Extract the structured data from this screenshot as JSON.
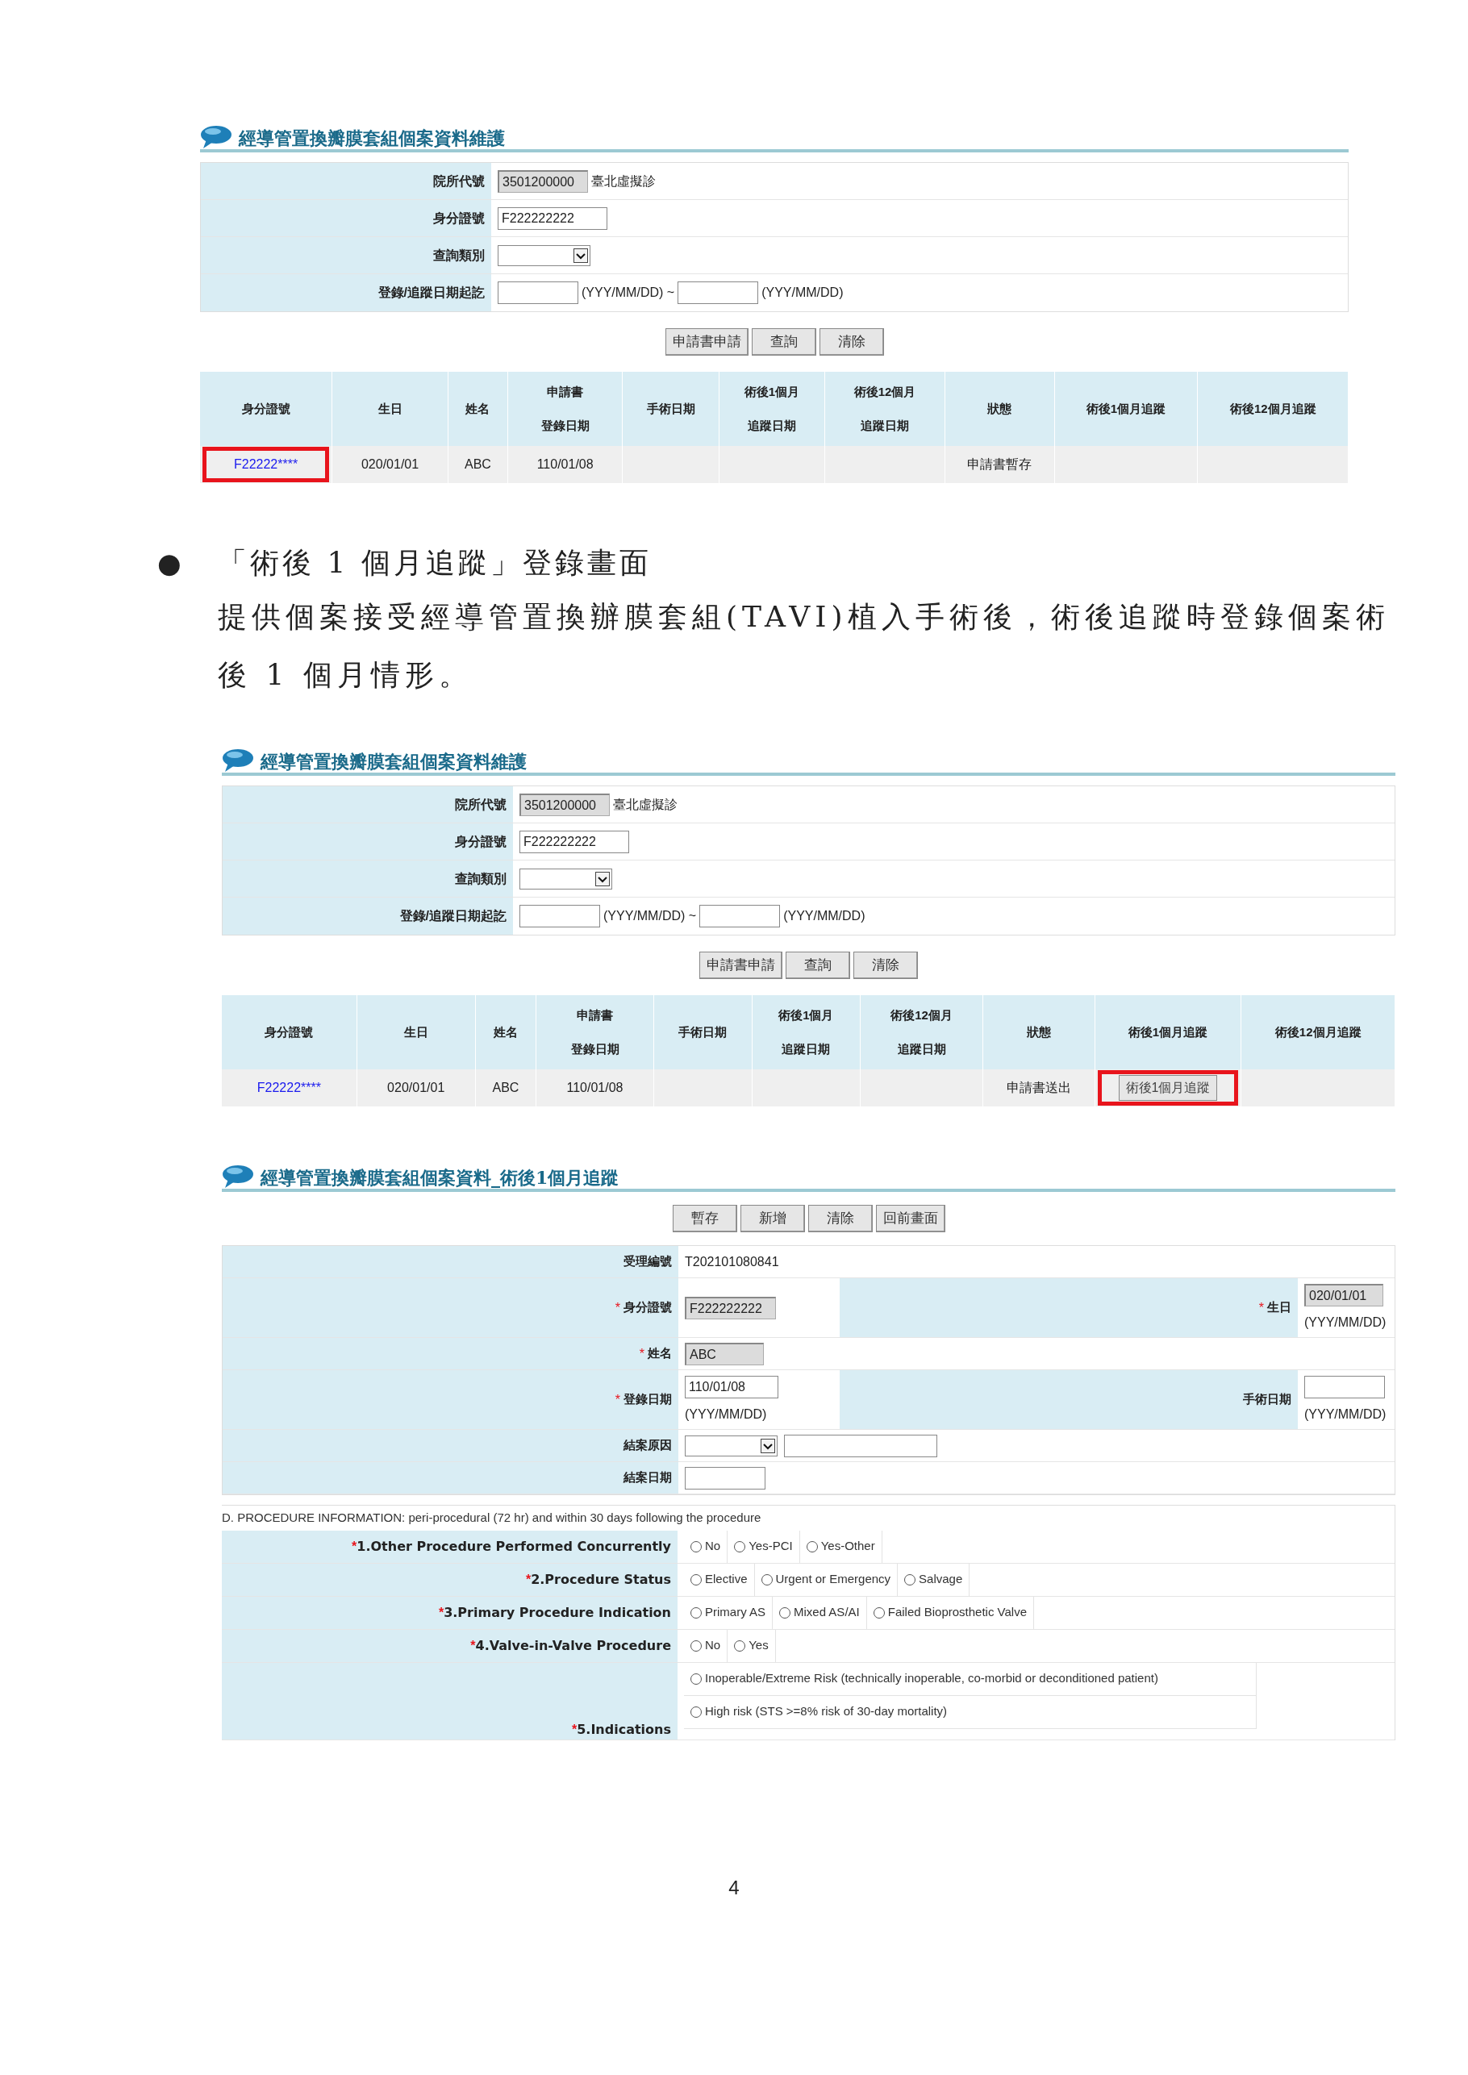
{
  "query_screens": [
    {
      "title": "經導管置換瓣膜套組個案資料維護",
      "fields": [
        {
          "label": "院所代號",
          "parts": [
            {
              "kind": "readonly",
              "value": "3501200000"
            },
            {
              "kind": "text",
              "text": "臺北虛擬診"
            }
          ]
        },
        {
          "label": "身分證號",
          "parts": [
            {
              "kind": "input",
              "value": "F222222222"
            }
          ]
        },
        {
          "label": "查詢類別",
          "parts": [
            {
              "kind": "select"
            }
          ]
        },
        {
          "label": "登錄/追蹤日期起訖",
          "parts": [
            {
              "kind": "input"
            },
            {
              "kind": "text",
              "text": "(YYY/MM/DD) ~"
            },
            {
              "kind": "input"
            },
            {
              "kind": "text",
              "text": "(YYY/MM/DD)"
            }
          ]
        }
      ],
      "buttons": [
        "申請書申請",
        "查詢",
        "清除"
      ],
      "columns": [
        {
          "lines": [
            "身分證號"
          ]
        },
        {
          "lines": [
            "生日"
          ]
        },
        {
          "lines": [
            "姓名"
          ]
        },
        {
          "lines": [
            "申請書",
            "登錄日期"
          ]
        },
        {
          "lines": [
            "手術日期"
          ]
        },
        {
          "lines": [
            "術後1個月",
            "追蹤日期"
          ]
        },
        {
          "lines": [
            "術後12個月",
            "追蹤日期"
          ]
        },
        {
          "lines": [
            "狀態"
          ]
        },
        {
          "lines": [
            "術後1個月追蹤"
          ]
        },
        {
          "lines": [
            "術後12個月追蹤"
          ]
        }
      ],
      "rows": [
        {
          "cells": [
            {
              "kind": "link",
              "text": "F22222****",
              "highlighted": true
            },
            {
              "kind": "text",
              "text": "020/01/01",
              "highlighted": false
            },
            {
              "kind": "text",
              "text": "ABC",
              "highlighted": false
            },
            {
              "kind": "text",
              "text": "110/01/08",
              "highlighted": false
            },
            {
              "kind": "empty",
              "highlighted": false
            },
            {
              "kind": "empty",
              "highlighted": false
            },
            {
              "kind": "empty",
              "highlighted": false
            },
            {
              "kind": "text",
              "text": "申請書暫存",
              "highlighted": false
            },
            {
              "kind": "empty",
              "highlighted": false
            },
            {
              "kind": "empty",
              "highlighted": false
            }
          ]
        }
      ]
    },
    {
      "title": "經導管置換瓣膜套組個案資料維護",
      "fields": [
        {
          "label": "院所代號",
          "parts": [
            {
              "kind": "readonly",
              "value": "3501200000"
            },
            {
              "kind": "text",
              "text": "臺北虛擬診"
            }
          ]
        },
        {
          "label": "身分證號",
          "parts": [
            {
              "kind": "input",
              "value": "F222222222"
            }
          ]
        },
        {
          "label": "查詢類別",
          "parts": [
            {
              "kind": "select"
            }
          ]
        },
        {
          "label": "登錄/追蹤日期起訖",
          "parts": [
            {
              "kind": "input"
            },
            {
              "kind": "text",
              "text": "(YYY/MM/DD) ~"
            },
            {
              "kind": "input"
            },
            {
              "kind": "text",
              "text": "(YYY/MM/DD)"
            }
          ]
        }
      ],
      "buttons": [
        "申請書申請",
        "查詢",
        "清除"
      ],
      "columns": [
        {
          "lines": [
            "身分證號"
          ]
        },
        {
          "lines": [
            "生日"
          ]
        },
        {
          "lines": [
            "姓名"
          ]
        },
        {
          "lines": [
            "申請書",
            "登錄日期"
          ]
        },
        {
          "lines": [
            "手術日期"
          ]
        },
        {
          "lines": [
            "術後1個月",
            "追蹤日期"
          ]
        },
        {
          "lines": [
            "術後12個月",
            "追蹤日期"
          ]
        },
        {
          "lines": [
            "狀態"
          ]
        },
        {
          "lines": [
            "術後1個月追蹤"
          ]
        },
        {
          "lines": [
            "術後12個月追蹤"
          ]
        }
      ],
      "rows": [
        {
          "cells": [
            {
              "kind": "link",
              "text": "F22222****",
              "highlighted": false
            },
            {
              "kind": "text",
              "text": "020/01/01",
              "highlighted": false
            },
            {
              "kind": "text",
              "text": "ABC",
              "highlighted": false
            },
            {
              "kind": "text",
              "text": "110/01/08",
              "highlighted": false
            },
            {
              "kind": "empty",
              "highlighted": false
            },
            {
              "kind": "empty",
              "highlighted": false
            },
            {
              "kind": "empty",
              "highlighted": false
            },
            {
              "kind": "text",
              "text": "申請書送出",
              "highlighted": false
            },
            {
              "kind": "button",
              "text": "術後1個月追蹤",
              "highlighted": true
            },
            {
              "kind": "empty",
              "highlighted": false
            }
          ]
        }
      ]
    }
  ],
  "section": {
    "bullet": "●",
    "heading": "「術後 1 個月追蹤」登錄畫面",
    "paragraph": "提供個案接受經導管置換辦膜套組(TAVI)植入手術後，術後追蹤時登錄個案術後 1 個月情形。"
  },
  "followup_form": {
    "title": "經導管置換瓣膜套組個案資料_術後1個月追蹤",
    "buttons": [
      "暫存",
      "新增",
      "清除",
      "回前畫面"
    ],
    "rows": [
      {
        "label": "受理編號",
        "parts": [
          {
            "kind": "text",
            "text": "T202101080841"
          }
        ]
      },
      {
        "mark": "*",
        "label": "身分證號",
        "parts": [
          {
            "kind": "readonly",
            "value": "F222222222"
          }
        ],
        "pair": {
          "mark": "*",
          "label": "生日",
          "parts": [
            {
              "kind": "readonly",
              "value": "020/01/01"
            },
            {
              "kind": "text",
              "text": "(YYY/MM/DD)"
            }
          ]
        }
      },
      {
        "mark": "*",
        "label": "姓名",
        "parts": [
          {
            "kind": "readonly",
            "value": "ABC"
          }
        ]
      },
      {
        "mark": "*",
        "label": "登錄日期",
        "parts": [
          {
            "kind": "input",
            "value": "110/01/08"
          },
          {
            "kind": "text",
            "text": "(YYY/MM/DD)"
          }
        ],
        "pair": {
          "label": "手術日期",
          "parts": [
            {
              "kind": "input"
            },
            {
              "kind": "text",
              "text": "(YYY/MM/DD)"
            }
          ]
        }
      },
      {
        "label": "結案原因",
        "parts": [
          {
            "kind": "select"
          },
          {
            "kind": "wide_input"
          }
        ]
      },
      {
        "label": "結案日期",
        "parts": [
          {
            "kind": "input"
          }
        ]
      }
    ],
    "procedure": {
      "caption": "D. PROCEDURE INFORMATION: peri-procedural (72 hr) and within 30 days following the procedure",
      "questions": [
        {
          "mark": "*",
          "label": "1.Other Procedure Performed Concurrently",
          "kind": "inline",
          "options": [
            {
              "label": "No",
              "selected": false
            },
            {
              "label": "Yes-PCI",
              "selected": false
            },
            {
              "label": "Yes-Other",
              "selected": false
            }
          ]
        },
        {
          "mark": "*",
          "label": "2.Procedure Status",
          "kind": "inline",
          "options": [
            {
              "label": "Elective",
              "selected": false
            },
            {
              "label": "Urgent or Emergency",
              "selected": false
            },
            {
              "label": "Salvage",
              "selected": false
            }
          ]
        },
        {
          "mark": "*",
          "label": "3.Primary Procedure Indication",
          "kind": "inline",
          "options": [
            {
              "label": "Primary AS",
              "selected": false
            },
            {
              "label": "Mixed AS/AI",
              "selected": false
            },
            {
              "label": "Failed Bioprosthetic Valve",
              "selected": false
            }
          ]
        },
        {
          "mark": "*",
          "label": "4.Valve-in-Valve Procedure",
          "kind": "inline",
          "options": [
            {
              "label": "No",
              "selected": false
            },
            {
              "label": "Yes",
              "selected": false
            }
          ]
        },
        {
          "mark": "*",
          "label": "5.Indications",
          "kind": "stacked",
          "options": [
            {
              "label": "Inoperable/Extreme Risk (technically inoperable, co-morbid or deconditioned patient)",
              "selected": false
            },
            {
              "label": "High risk (STS >=8% risk of 30-day mortality)",
              "selected": false
            }
          ]
        }
      ]
    }
  },
  "page_number": "4"
}
